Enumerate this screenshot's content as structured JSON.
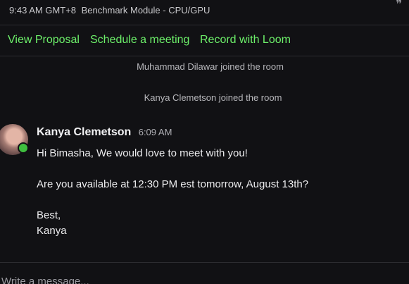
{
  "header": {
    "time": "9:43 AM GMT+8",
    "title": "Benchmark Module - CPU/GPU",
    "corner_icon": "quote-icon"
  },
  "actions": {
    "view_proposal": "View Proposal",
    "schedule_meeting": "Schedule a meeting",
    "record_loom": "Record with Loom"
  },
  "system_messages": [
    "Muhammad Dilawar joined the room",
    "Kanya Clemetson joined the room"
  ],
  "message": {
    "author": "Kanya Clemetson",
    "timestamp": "6:09 AM",
    "status": "online",
    "lines": [
      "Hi Bimasha, We would love to meet with you!",
      "Are you available at 12:30 PM est tomorrow, August 13th?",
      "Best,",
      "Kanya"
    ]
  },
  "composer": {
    "placeholder": "Write a message..."
  },
  "colors": {
    "background": "#111114",
    "accent_link": "#6df06a",
    "online_dot": "#3fbf3f"
  }
}
